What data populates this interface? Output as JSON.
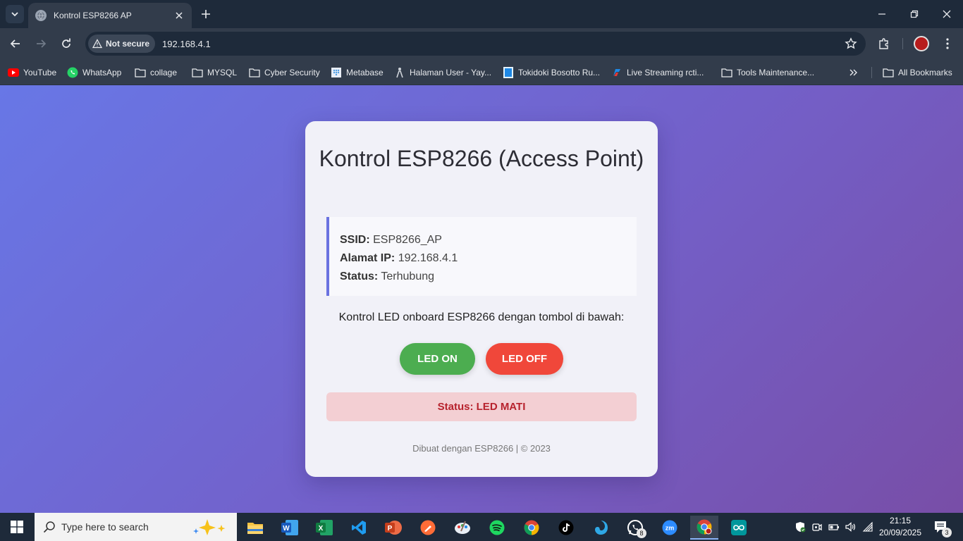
{
  "browser": {
    "tab_title": "Kontrol ESP8266 AP",
    "security_label": "Not secure",
    "url": "192.168.4.1",
    "bookmarks": [
      {
        "label": "YouTube",
        "icon": "youtube-icon"
      },
      {
        "label": "WhatsApp",
        "icon": "whatsapp-icon"
      },
      {
        "label": "collage",
        "icon": "folder-icon"
      },
      {
        "label": "MYSQL",
        "icon": "folder-icon"
      },
      {
        "label": "Cyber Security",
        "icon": "folder-icon"
      },
      {
        "label": "Metabase",
        "icon": "metabase-icon"
      },
      {
        "label": "Halaman User - Yay...",
        "icon": "user-site-icon"
      },
      {
        "label": "Tokidoki Bosotto Ru...",
        "icon": "bookmark-site-icon"
      },
      {
        "label": "Live Streaming rcti...",
        "icon": "rcti-icon"
      },
      {
        "label": "Tools Maintenance...",
        "icon": "folder-icon"
      }
    ],
    "all_bookmarks": "All Bookmarks"
  },
  "page": {
    "title": "Kontrol ESP8266 (Access Point)",
    "info": {
      "ssid_label": "SSID:",
      "ssid_value": "ESP8266_AP",
      "ip_label": "Alamat IP:",
      "ip_value": "192.168.4.1",
      "status_label": "Status:",
      "status_value": "Terhubung"
    },
    "description": "Kontrol LED onboard ESP8266 dengan tombol di bawah:",
    "btn_on": "LED ON",
    "btn_off": "LED OFF",
    "led_status": "Status: LED MATI",
    "footer": "Dibuat dengan ESP8266 | © 2023"
  },
  "taskbar": {
    "search_placeholder": "Type here to search",
    "whatsapp_badge": "8",
    "time": "21:15",
    "date": "20/09/2025",
    "notification_count": "3"
  },
  "colors": {
    "accent_blue": "#6a72e0",
    "led_on_green": "#4cad50",
    "led_off_red": "#f0473a",
    "status_text": "#b7222d"
  }
}
